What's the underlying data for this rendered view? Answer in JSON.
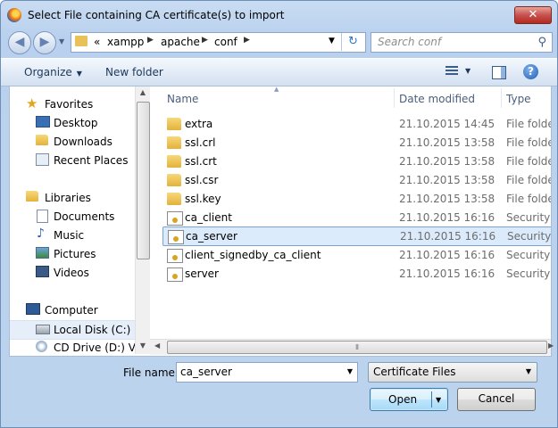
{
  "window": {
    "title": "Select File containing CA certificate(s) to import",
    "close_glyph": "✕"
  },
  "nav": {
    "back_glyph": "◀",
    "forward_glyph": "▶"
  },
  "address": {
    "chevrons": "«",
    "path": [
      "xampp",
      "apache",
      "conf"
    ],
    "separator": "▶"
  },
  "search": {
    "placeholder": "Search conf"
  },
  "toolbar": {
    "organize": "Organize",
    "new_folder": "New folder",
    "help_glyph": "?"
  },
  "sidebar": {
    "items": [
      {
        "label": "Favorites",
        "icon": "star-icon"
      },
      {
        "label": "Desktop",
        "icon": "desktop-icon"
      },
      {
        "label": "Downloads",
        "icon": "downloads-icon"
      },
      {
        "label": "Recent Places",
        "icon": "recent-places-icon"
      },
      {
        "label": "Libraries",
        "icon": "libraries-icon"
      },
      {
        "label": "Documents",
        "icon": "documents-icon"
      },
      {
        "label": "Music",
        "icon": "music-icon"
      },
      {
        "label": "Pictures",
        "icon": "pictures-icon"
      },
      {
        "label": "Videos",
        "icon": "videos-icon"
      },
      {
        "label": "Computer",
        "icon": "computer-icon"
      },
      {
        "label": "Local Disk (C:)",
        "icon": "disk-icon",
        "selected": true
      },
      {
        "label": "CD Drive (D:) Virt",
        "icon": "cd-drive-icon"
      }
    ]
  },
  "columns": {
    "name": "Name",
    "date": "Date modified",
    "type": "Type"
  },
  "files": [
    {
      "name": "extra",
      "date": "21.10.2015 14:45",
      "type": "File folder",
      "icon": "folder-icon"
    },
    {
      "name": "ssl.crl",
      "date": "21.10.2015 13:58",
      "type": "File folder",
      "icon": "folder-icon"
    },
    {
      "name": "ssl.crt",
      "date": "21.10.2015 13:58",
      "type": "File folder",
      "icon": "folder-icon"
    },
    {
      "name": "ssl.csr",
      "date": "21.10.2015 13:58",
      "type": "File folder",
      "icon": "folder-icon"
    },
    {
      "name": "ssl.key",
      "date": "21.10.2015 13:58",
      "type": "File folder",
      "icon": "folder-icon"
    },
    {
      "name": "ca_client",
      "date": "21.10.2015 16:16",
      "type": "Security C",
      "icon": "certificate-icon"
    },
    {
      "name": "ca_server",
      "date": "21.10.2015 16:16",
      "type": "Security C",
      "icon": "certificate-icon",
      "selected": true
    },
    {
      "name": "client_signedby_ca_client",
      "date": "21.10.2015 16:16",
      "type": "Security C",
      "icon": "certificate-icon"
    },
    {
      "name": "server",
      "date": "21.10.2015 16:16",
      "type": "Security C",
      "icon": "certificate-icon"
    }
  ],
  "filename": {
    "label": "File name:",
    "value": "ca_server"
  },
  "filter": {
    "selected": "Certificate Files"
  },
  "buttons": {
    "open": "Open",
    "cancel": "Cancel"
  },
  "colors": {
    "selection": "#dcebfc",
    "selection_border": "#7da2ce",
    "chrome": "#c9dcf2"
  }
}
